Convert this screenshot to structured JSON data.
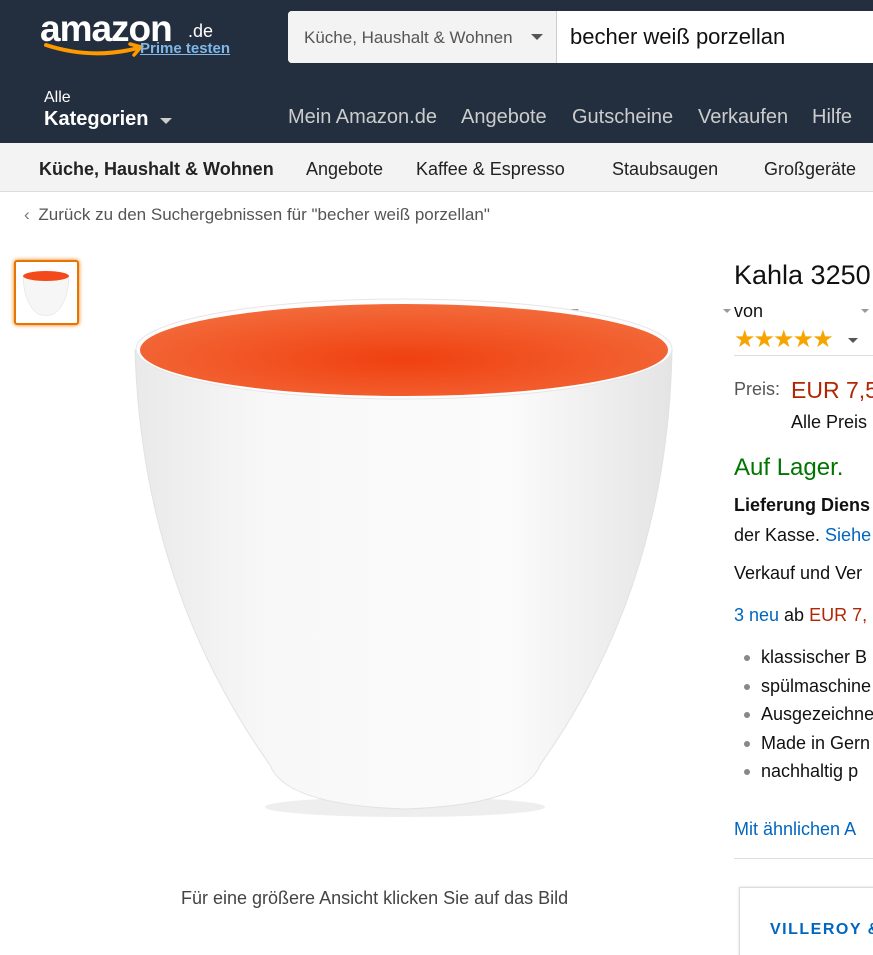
{
  "header": {
    "logo_word": "amazon",
    "logo_tld": ".de",
    "prime_link": "Prime testen",
    "search_department": "Küche, Haushalt & Wohnen",
    "search_query": "becher weiß porzellan",
    "categories_small": "Alle",
    "categories_big": "Kategorien",
    "nav": [
      "Mein Amazon.de",
      "Angebote",
      "Gutscheine",
      "Verkaufen",
      "Hilfe"
    ]
  },
  "subnav": {
    "items": [
      "Küche, Haushalt & Wohnen",
      "Angebote",
      "Kaffee & Espresso",
      "Staubsaugen",
      "Großgeräte"
    ]
  },
  "breadcrumb": {
    "back_text": "Zurück zu den Suchergebnissen für \"becher weiß porzellan\""
  },
  "gallery": {
    "caption": "Für eine größere Ansicht klicken Sie auf das Bild"
  },
  "product": {
    "title": "Kahla 3250",
    "by": "von",
    "stars": "★★★★★",
    "price_label": "Preis:",
    "price": "EUR 7,5",
    "all_prices": "Alle Preis",
    "availability": "Auf Lager.",
    "delivery": "Lieferung Diens",
    "checkout_prefix": "der Kasse. ",
    "checkout_link": "Siehe",
    "sold_by": "Verkauf und Ver",
    "offers_link": "3 neu",
    "offers_mid": " ab ",
    "offers_price": "EUR 7,",
    "bullets": [
      "klassischer B",
      "spülmaschine",
      "Ausgezeichne",
      "Made in Gern",
      "nachhaltig p"
    ],
    "similar_link": "Mit ähnlichen A",
    "brand": "VILLEROY &"
  },
  "colors": {
    "header_bg": "#232f3e",
    "price": "#b12704",
    "in_stock": "#007600",
    "link": "#0066c0",
    "cup_inner": "#f24a1b"
  }
}
